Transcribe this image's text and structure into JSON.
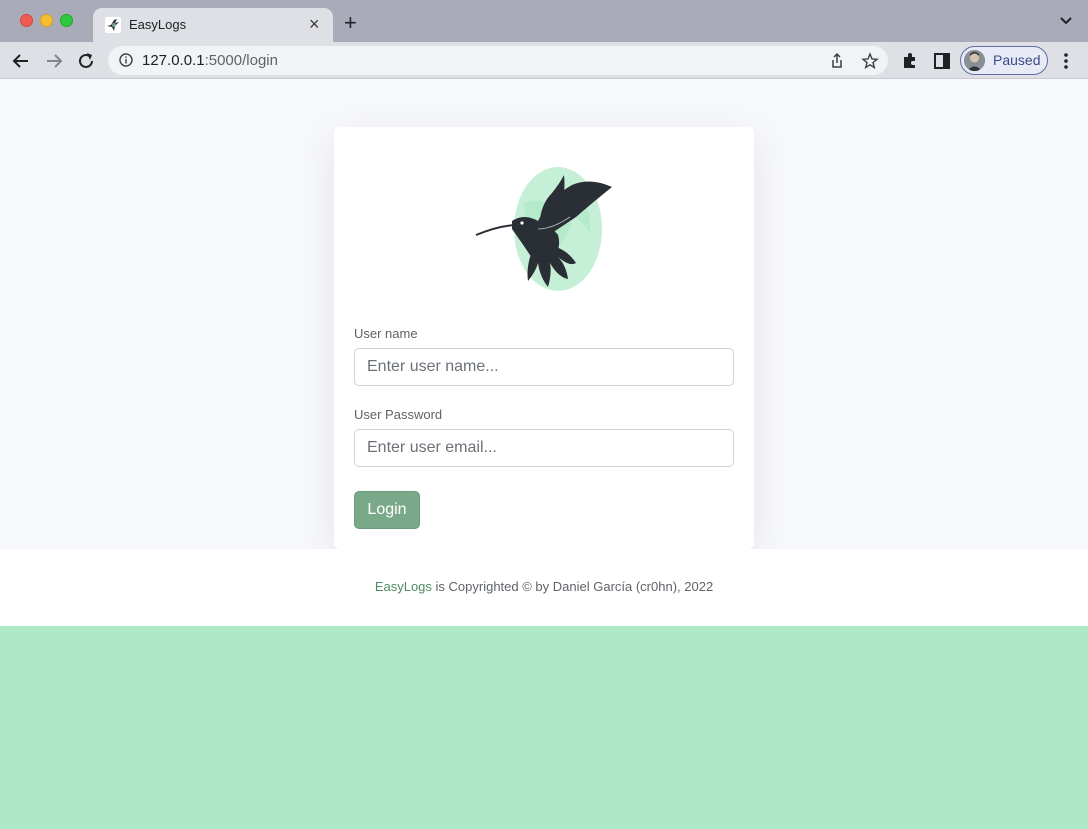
{
  "browser": {
    "tab_title": "EasyLogs",
    "url_host": "127.0.0.1",
    "url_path": ":5000/login",
    "profile_label": "Paused"
  },
  "login": {
    "username_label": "User name",
    "username_placeholder": "Enter user name...",
    "password_label": "User Password",
    "password_placeholder": "Enter user email...",
    "submit_label": "Login"
  },
  "footer": {
    "brand": "EasyLogs",
    "copyright": " is Copyrighted © by Daniel García (cr0hn), 2022"
  },
  "colors": {
    "accent": "#7aa98a",
    "bottom_band": "#ade9c6",
    "brand_link": "#4f8a66"
  }
}
